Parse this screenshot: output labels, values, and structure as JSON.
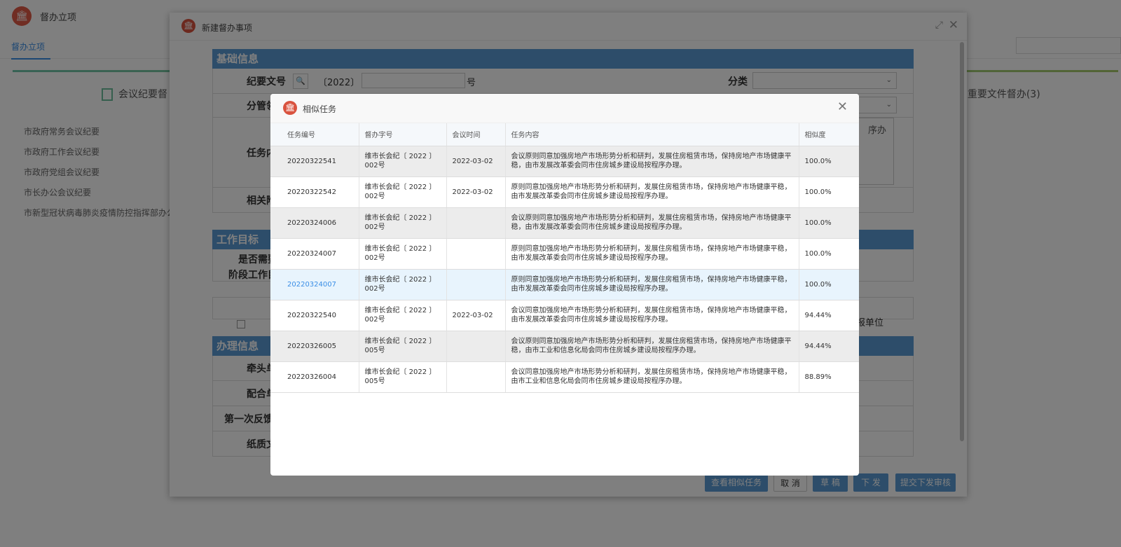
{
  "app": {
    "title": "督办立项",
    "tab": "督办立项"
  },
  "background": {
    "left_category": "会议纪要督",
    "right_category": "E重要文件督办(3)",
    "meetings": [
      "市政府常务会议纪要",
      "市政府工作会议纪要",
      "市政府党组会议纪要",
      "市长办公会议纪要",
      "市新型冠状病毒肺炎疫情防控指挥部办公"
    ]
  },
  "outer_dialog": {
    "title": "新建督办事项",
    "sections": {
      "basic": "基础信息",
      "goal": "工作目标",
      "handle": "办理信息"
    },
    "labels": {
      "doc_no": "纪要文号",
      "year": "〔2022〕",
      "hao": "号",
      "category": "分类",
      "fenguan": "分管领",
      "task": "任务内",
      "related": "相关附",
      "need": "是否需要",
      "stage": "阶段工作目",
      "lead": "牵头单",
      "cooperate": "配合单",
      "first_feedback": "第一次反馈",
      "paper": "纸质文",
      "report_unit": "报单位",
      "textarea_snippet": "序办"
    },
    "buttons": {
      "view_similar": "查看相似任务",
      "cancel": "取 消",
      "draft": "草 稿",
      "issue": "下 发",
      "submit_review": "提交下发审核"
    }
  },
  "modal": {
    "title": "相似任务",
    "columns": [
      "任务编号",
      "督办字号",
      "会议时间",
      "任务内容",
      "相似度"
    ],
    "rows": [
      {
        "id": "20220322541",
        "doc": "维市长会纪〔 2022 〕002号",
        "date": "2022-03-02",
        "content": "会议原则同意加强房地产市场形势分析和研判，发展住房租赁市场，保持房地产市场健康平稳，由市发展改革委会同市住房城乡建设局按程序办理。",
        "similarity": "100.0%"
      },
      {
        "id": "20220322542",
        "doc": "维市长会纪〔 2022 〕002号",
        "date": "2022-03-02",
        "content": "原则同意加强房地产市场形势分析和研判，发展住房租赁市场，保持房地产市场健康平稳，由市发展改革委会同市住房城乡建设局按程序办理。",
        "similarity": "100.0%"
      },
      {
        "id": "20220324006",
        "doc": "维市长会纪〔 2022 〕002号",
        "date": "",
        "content": "会议原则同意加强房地产市场形势分析和研判，发展住房租赁市场，保持房地产市场健康平稳，由市发展改革委会同市住房城乡建设局按程序办理。",
        "similarity": "100.0%"
      },
      {
        "id": "20220324007",
        "doc": "维市长会纪〔 2022 〕002号",
        "date": "",
        "content": "原则同意加强房地产市场形势分析和研判，发展住房租赁市场，保持房地产市场健康平稳，由市发展改革委会同市住房城乡建设局按程序办理。",
        "similarity": "100.0%"
      },
      {
        "id": "20220324007",
        "doc": "维市长会纪〔 2022 〕002号",
        "date": "",
        "content": "原则同意加强房地产市场形势分析和研判，发展住房租赁市场，保持房地产市场健康平稳，由市发展改革委会同市住房城乡建设局按程序办理。",
        "similarity": "100.0%"
      },
      {
        "id": "20220322540",
        "doc": "维市长会纪〔 2022 〕002号",
        "date": "2022-03-02",
        "content": "会议同意加强房地产市场形势分析和研判，发展住房租赁市场，保持房地产市场健康平稳，由市发展改革委会同市住房城乡建设局按程序办理。",
        "similarity": "94.44%"
      },
      {
        "id": "20220326005",
        "doc": "维市长会纪〔 2022 〕005号",
        "date": "",
        "content": "会议原则同意加强房地产市场形势分析和研判，发展住房租赁市场，保持房地产市场健康平稳，由市工业和信息化局会同市住房城乡建设局按程序办理。",
        "similarity": "94.44%"
      },
      {
        "id": "20220326004",
        "doc": "维市长会纪〔 2022 〕005号",
        "date": "",
        "content": "会议同意加强房地产市场形势分析和研判，发展住房租赁市场，保持房地产市场健康平稳，由市工业和信息化局会同市住房城乡建设局按程序办理。",
        "similarity": "88.89%"
      }
    ]
  }
}
